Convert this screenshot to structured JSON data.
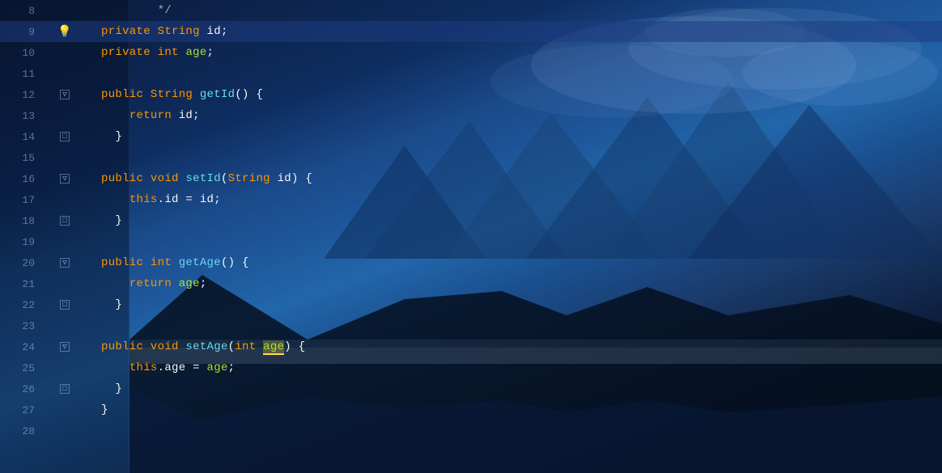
{
  "background": {
    "description": "Night sky with mountains and lake reflection"
  },
  "editor": {
    "lines": [
      {
        "num": 8,
        "gutter": "",
        "content": [
          {
            "t": "  */",
            "cls": "comment"
          }
        ],
        "highlighted": false
      },
      {
        "num": 9,
        "gutter": "bulb",
        "content": [
          {
            "t": "  ",
            "cls": "plain"
          },
          {
            "t": "private",
            "cls": "kw-private"
          },
          {
            "t": " ",
            "cls": "plain"
          },
          {
            "t": "String",
            "cls": "type-string"
          },
          {
            "t": " id;",
            "cls": "plain"
          }
        ],
        "highlighted": true
      },
      {
        "num": 10,
        "gutter": "",
        "content": [
          {
            "t": "  ",
            "cls": "plain"
          },
          {
            "t": "private",
            "cls": "kw-private"
          },
          {
            "t": " ",
            "cls": "plain"
          },
          {
            "t": "int",
            "cls": "type-int"
          },
          {
            "t": " ",
            "cls": "plain"
          },
          {
            "t": "age",
            "cls": "var-name"
          },
          {
            "t": ";",
            "cls": "plain"
          }
        ],
        "highlighted": false
      },
      {
        "num": 11,
        "gutter": "",
        "content": [],
        "highlighted": false
      },
      {
        "num": 12,
        "gutter": "fold",
        "content": [
          {
            "t": "  ",
            "cls": "plain"
          },
          {
            "t": "public",
            "cls": "kw-public"
          },
          {
            "t": " ",
            "cls": "plain"
          },
          {
            "t": "String",
            "cls": "type-string"
          },
          {
            "t": " ",
            "cls": "plain"
          },
          {
            "t": "getId",
            "cls": "method"
          },
          {
            "t": "() {",
            "cls": "plain"
          }
        ],
        "highlighted": false
      },
      {
        "num": 13,
        "gutter": "",
        "content": [
          {
            "t": "    ",
            "cls": "plain"
          },
          {
            "t": "return",
            "cls": "kw-return"
          },
          {
            "t": " id;",
            "cls": "plain"
          }
        ],
        "highlighted": false
      },
      {
        "num": 14,
        "gutter": "fold",
        "content": [
          {
            "t": "  }",
            "cls": "plain"
          }
        ],
        "highlighted": false
      },
      {
        "num": 15,
        "gutter": "",
        "content": [],
        "highlighted": false
      },
      {
        "num": 16,
        "gutter": "fold",
        "content": [
          {
            "t": "  ",
            "cls": "plain"
          },
          {
            "t": "public",
            "cls": "kw-public"
          },
          {
            "t": " ",
            "cls": "plain"
          },
          {
            "t": "void",
            "cls": "kw-void"
          },
          {
            "t": " ",
            "cls": "plain"
          },
          {
            "t": "setId",
            "cls": "method"
          },
          {
            "t": "(",
            "cls": "plain"
          },
          {
            "t": "String",
            "cls": "type-string"
          },
          {
            "t": " id) {",
            "cls": "plain"
          }
        ],
        "highlighted": false
      },
      {
        "num": 17,
        "gutter": "",
        "content": [
          {
            "t": "    ",
            "cls": "plain"
          },
          {
            "t": "this",
            "cls": "kw-this"
          },
          {
            "t": ".id = id;",
            "cls": "plain"
          }
        ],
        "highlighted": false
      },
      {
        "num": 18,
        "gutter": "fold",
        "content": [
          {
            "t": "  }",
            "cls": "plain"
          }
        ],
        "highlighted": false
      },
      {
        "num": 19,
        "gutter": "",
        "content": [],
        "highlighted": false
      },
      {
        "num": 20,
        "gutter": "fold",
        "content": [
          {
            "t": "  ",
            "cls": "plain"
          },
          {
            "t": "public",
            "cls": "kw-public"
          },
          {
            "t": " ",
            "cls": "plain"
          },
          {
            "t": "int",
            "cls": "type-int"
          },
          {
            "t": " ",
            "cls": "plain"
          },
          {
            "t": "getAge",
            "cls": "method"
          },
          {
            "t": "() {",
            "cls": "plain"
          }
        ],
        "highlighted": false
      },
      {
        "num": 21,
        "gutter": "",
        "content": [
          {
            "t": "    ",
            "cls": "plain"
          },
          {
            "t": "return",
            "cls": "kw-return"
          },
          {
            "t": " ",
            "cls": "plain"
          },
          {
            "t": "age",
            "cls": "var-name"
          },
          {
            "t": ";",
            "cls": "plain"
          }
        ],
        "highlighted": false
      },
      {
        "num": 22,
        "gutter": "fold",
        "content": [
          {
            "t": "  }",
            "cls": "plain"
          }
        ],
        "highlighted": false
      },
      {
        "num": 23,
        "gutter": "",
        "content": [],
        "highlighted": false
      },
      {
        "num": 24,
        "gutter": "fold",
        "content": [
          {
            "t": "  ",
            "cls": "plain"
          },
          {
            "t": "public",
            "cls": "kw-public"
          },
          {
            "t": " ",
            "cls": "plain"
          },
          {
            "t": "void",
            "cls": "kw-void"
          },
          {
            "t": " ",
            "cls": "plain"
          },
          {
            "t": "setAge",
            "cls": "method"
          },
          {
            "t": "(",
            "cls": "plain"
          },
          {
            "t": "int",
            "cls": "type-int"
          },
          {
            "t": " ",
            "cls": "plain"
          },
          {
            "t": "age",
            "cls": "highlight-age"
          },
          {
            "t": ") {",
            "cls": "plain"
          }
        ],
        "highlighted": false
      },
      {
        "num": 25,
        "gutter": "",
        "content": [
          {
            "t": "    ",
            "cls": "plain"
          },
          {
            "t": "this",
            "cls": "kw-this"
          },
          {
            "t": ".age = ",
            "cls": "plain"
          },
          {
            "t": "age",
            "cls": "var-name"
          },
          {
            "t": ";",
            "cls": "plain"
          }
        ],
        "highlighted": false
      },
      {
        "num": 26,
        "gutter": "fold",
        "content": [
          {
            "t": "  }",
            "cls": "plain"
          }
        ],
        "highlighted": false
      },
      {
        "num": 27,
        "gutter": "",
        "content": [
          {
            "t": "}",
            "cls": "plain"
          }
        ],
        "highlighted": false
      },
      {
        "num": 28,
        "gutter": "",
        "content": [],
        "highlighted": false
      }
    ]
  }
}
